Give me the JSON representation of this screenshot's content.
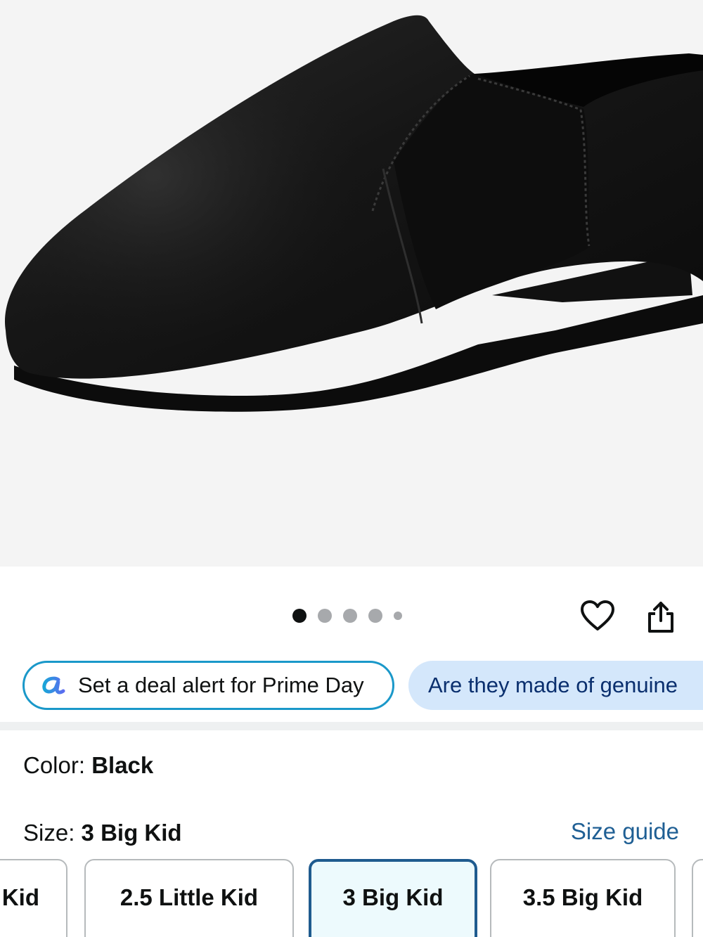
{
  "gallery": {
    "dot_count": 5,
    "active_index": 0
  },
  "actions": {
    "wishlist_icon": "heart-icon",
    "share_icon": "share-icon"
  },
  "chips": {
    "deal_alert": "Set a deal alert for Prime Day",
    "question": "Are they made of genuine"
  },
  "color": {
    "label": "Color: ",
    "value": "Black"
  },
  "size": {
    "label": "Size: ",
    "value": "3 Big Kid",
    "guide_link": "Size guide",
    "options": [
      "Kid",
      "2.5 Little Kid",
      "3 Big Kid",
      "3.5 Big Kid",
      ""
    ],
    "selected_index": 2
  },
  "colors": {
    "accent_blue": "#1f5b8f",
    "chip_border": "#1a98c9",
    "chip_fill": "#d4e7fb",
    "link": "#1f5f94"
  }
}
